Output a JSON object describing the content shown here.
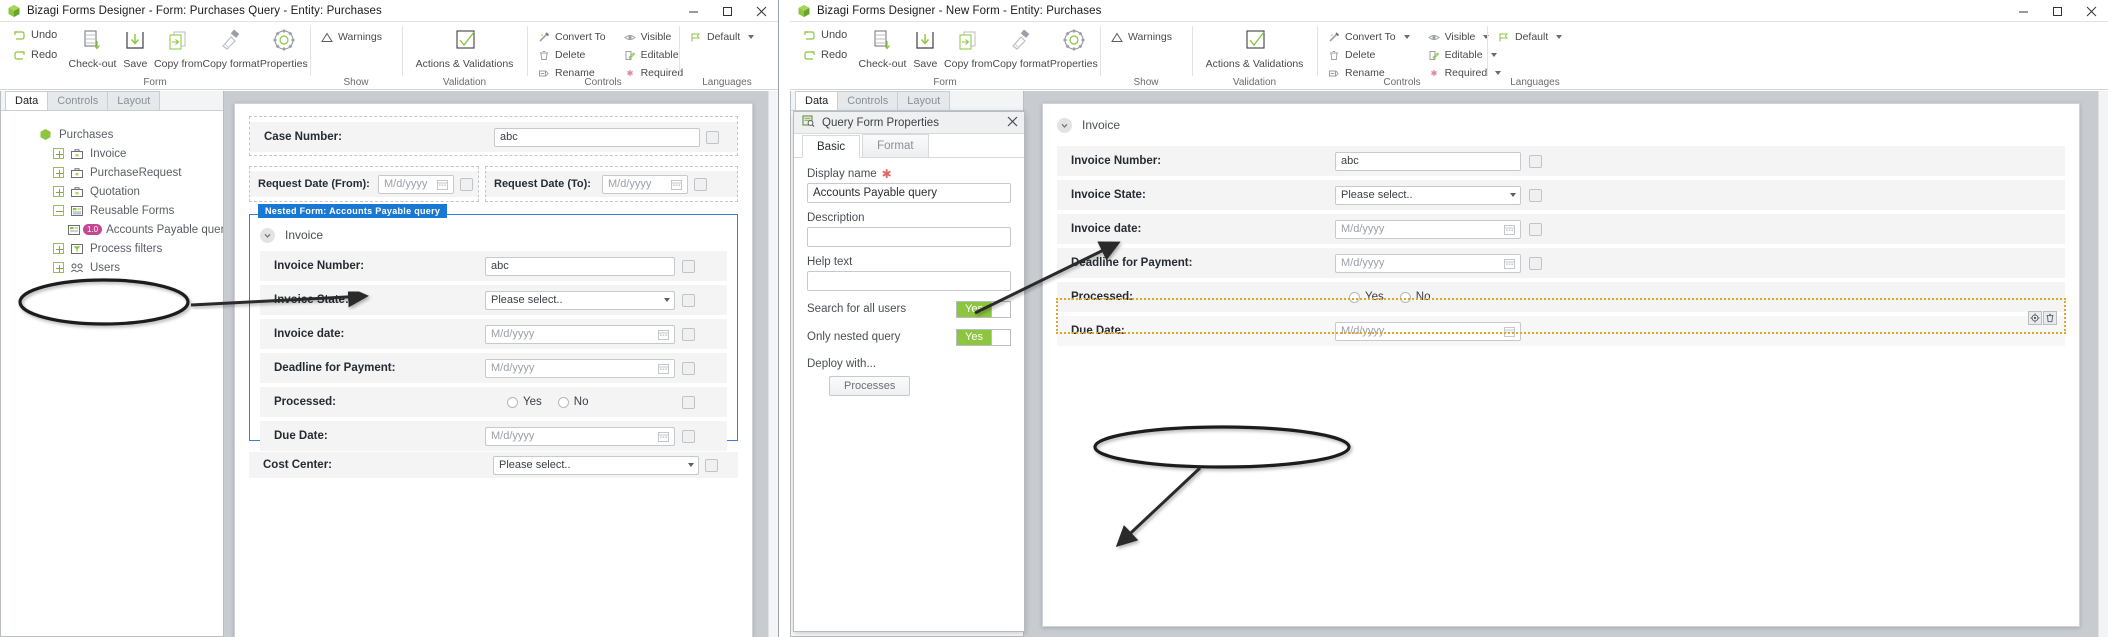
{
  "left_window": {
    "title": "Bizagi Forms Designer  - Form: Purchases Query - Entity:  Purchases",
    "window_controls": {
      "minimize": "minimize-icon",
      "maximize": "maximize-icon",
      "close": "close-icon"
    },
    "ribbon": {
      "groups": [
        {
          "label": "Form",
          "small_commands": [
            {
              "label": "Undo",
              "icon": "undo-icon"
            },
            {
              "label": "Redo",
              "icon": "redo-icon"
            }
          ],
          "big_commands": [
            {
              "label": "Check-out",
              "icon": "check-out-icon"
            },
            {
              "label": "Save",
              "icon": "save-icon"
            },
            {
              "label": "Copy from",
              "icon": "copy-from-icon"
            },
            {
              "label": "Copy format",
              "icon": "copy-format-icon"
            },
            {
              "label": "Properties",
              "icon": "gear-icon"
            }
          ]
        },
        {
          "label": "Show",
          "small_commands": [
            {
              "label": "Warnings",
              "icon": "warning-triangle-icon"
            }
          ],
          "big_commands": []
        },
        {
          "label": "Validation",
          "small_commands": [],
          "big_commands": [
            {
              "label": "Actions & Validations",
              "icon": "checkmark-box-icon"
            }
          ]
        },
        {
          "label": "Controls",
          "small_commands": [
            {
              "label": "Convert To",
              "icon": "convert-to-icon"
            },
            {
              "label": "Delete",
              "icon": "trash-icon"
            },
            {
              "label": "Rename",
              "icon": "rename-icon"
            }
          ],
          "small_commands_2": [
            {
              "label": "Visible",
              "icon": "eye-icon"
            },
            {
              "label": "Editable",
              "icon": "editable-icon"
            },
            {
              "label": "Required",
              "icon": "asterisk-icon"
            }
          ],
          "big_commands": []
        },
        {
          "label": "Languages",
          "small_commands": [
            {
              "label": "Default",
              "icon": "flag-icon",
              "has_caret": true
            }
          ],
          "big_commands": []
        }
      ]
    },
    "panel_tabs": [
      {
        "label": "Data",
        "active": true
      },
      {
        "label": "Controls",
        "active": false
      },
      {
        "label": "Layout",
        "active": false
      }
    ],
    "tree": [
      {
        "label": "Purchases",
        "indent": 0,
        "icon": "entity-icon",
        "expander": "none"
      },
      {
        "label": "Invoice",
        "indent": 1,
        "icon": "briefcase-icon",
        "expander": "plus"
      },
      {
        "label": "PurchaseRequest",
        "indent": 1,
        "icon": "briefcase-icon",
        "expander": "plus"
      },
      {
        "label": "Quotation",
        "indent": 1,
        "icon": "briefcase-icon",
        "expander": "plus"
      },
      {
        "label": "Reusable Forms",
        "indent": 1,
        "icon": "reusable-forms-icon",
        "expander": "minus"
      },
      {
        "label": "Accounts Payable query",
        "indent": 2,
        "icon": "query-form-icon",
        "expander": "none",
        "badge": "1.0"
      },
      {
        "label": "Process filters",
        "indent": 1,
        "icon": "filter-icon",
        "expander": "plus"
      },
      {
        "label": "Users",
        "indent": 1,
        "icon": "users-icon",
        "expander": "plus"
      }
    ],
    "form": {
      "fields": [
        {
          "label": "Case Number:",
          "type": "text",
          "value": "abc"
        },
        {
          "label": "Request Date (From):",
          "type": "date",
          "placeholder": "M/d/yyyy"
        },
        {
          "label": "Request Date (To):",
          "type": "date",
          "placeholder": "M/d/yyyy"
        }
      ],
      "nested_form_tag": "Nested Form: Accounts Payable query",
      "nested_section_title": "Invoice",
      "nested_fields": [
        {
          "label": "Invoice Number:",
          "type": "text",
          "value": "abc"
        },
        {
          "label": "Invoice State:",
          "type": "select",
          "value": "Please select.."
        },
        {
          "label": "Invoice date:",
          "type": "date",
          "placeholder": "M/d/yyyy"
        },
        {
          "label": "Deadline for Payment:",
          "type": "date",
          "placeholder": "M/d/yyyy"
        },
        {
          "label": "Processed:",
          "type": "radio",
          "options": [
            "Yes",
            "No"
          ]
        },
        {
          "label": "Due Date:",
          "type": "date",
          "placeholder": "M/d/yyyy"
        }
      ],
      "bottom_field": {
        "label": "Cost Center:",
        "type": "select",
        "value": "Please select.."
      }
    }
  },
  "right_window": {
    "title": "Bizagi Forms Designer  - New Form - Entity:  Purchases",
    "ribbon": {
      "groups": [
        {
          "label": "Form",
          "small_commands": [
            {
              "label": "Undo",
              "icon": "undo-icon"
            },
            {
              "label": "Redo",
              "icon": "redo-icon"
            }
          ],
          "big_commands": [
            {
              "label": "Check-out",
              "icon": "check-out-icon"
            },
            {
              "label": "Save",
              "icon": "save-icon"
            },
            {
              "label": "Copy from",
              "icon": "copy-from-icon"
            },
            {
              "label": "Copy format",
              "icon": "copy-format-icon"
            },
            {
              "label": "Properties",
              "icon": "gear-icon"
            }
          ]
        },
        {
          "label": "Show",
          "small_commands": [
            {
              "label": "Warnings",
              "icon": "warning-triangle-icon"
            }
          ],
          "big_commands": []
        },
        {
          "label": "Validation",
          "small_commands": [],
          "big_commands": [
            {
              "label": "Actions & Validations",
              "icon": "checkmark-box-icon"
            }
          ]
        },
        {
          "label": "Controls",
          "small_commands": [
            {
              "label": "Convert To",
              "icon": "convert-to-icon",
              "has_caret": true
            },
            {
              "label": "Delete",
              "icon": "trash-icon"
            },
            {
              "label": "Rename",
              "icon": "rename-icon"
            }
          ],
          "small_commands_2": [
            {
              "label": "Visible",
              "icon": "eye-icon",
              "has_caret": true
            },
            {
              "label": "Editable",
              "icon": "editable-icon",
              "has_caret": true
            },
            {
              "label": "Required",
              "icon": "asterisk-icon",
              "has_caret": true
            }
          ],
          "big_commands": []
        },
        {
          "label": "Languages",
          "small_commands": [
            {
              "label": "Default",
              "icon": "flag-icon",
              "has_caret": true
            }
          ],
          "big_commands": []
        }
      ]
    },
    "panel_tabs": [
      {
        "label": "Data",
        "active": true
      },
      {
        "label": "Controls",
        "active": false
      },
      {
        "label": "Layout",
        "active": false
      }
    ],
    "properties_dialog": {
      "title": "Query Form Properties",
      "title_icon": "query-form-properties-icon",
      "close_icon": "close-icon",
      "tabs": [
        {
          "label": "Basic",
          "active": true
        },
        {
          "label": "Format",
          "active": false
        }
      ],
      "fields": [
        {
          "label": "Display name",
          "required": true,
          "value": "Accounts Payable query"
        },
        {
          "label": "Description",
          "required": false,
          "value": ""
        },
        {
          "label": "Help text",
          "required": false,
          "value": ""
        }
      ],
      "toggles": [
        {
          "label": "Search for all users",
          "value": "Yes"
        },
        {
          "label": "Only nested query",
          "value": "Yes"
        }
      ],
      "deploy_label": "Deploy with...",
      "deploy_button": "Processes"
    },
    "form": {
      "section_title": "Invoice",
      "fields": [
        {
          "label": "Invoice Number:",
          "type": "text",
          "value": "abc"
        },
        {
          "label": "Invoice State:",
          "type": "select",
          "value": "Please select.."
        },
        {
          "label": "Invoice date:",
          "type": "date",
          "placeholder": "M/d/yyyy"
        },
        {
          "label": "Deadline for Payment:",
          "type": "date",
          "placeholder": "M/d/yyyy"
        },
        {
          "label": "Processed:",
          "type": "radio",
          "options": [
            "Yes",
            "No"
          ]
        },
        {
          "label": "Due Date:",
          "type": "date",
          "placeholder": "M/d/yyyy",
          "selected": true
        }
      ],
      "selected_row_tools": [
        "gear-icon",
        "trash-icon"
      ]
    }
  },
  "annotations": {
    "ellipse_tree_item": "Accounts Payable query",
    "ellipse_toggle": "Only nested query",
    "arrow_1": "tree-item-to-nested-form-tag",
    "arrow_2": "nested-form-to-display-name",
    "arrow_3": "only-nested-query-to-form"
  },
  "colors": {
    "accent_green": "#8cc63e",
    "nested_blue": "#1878d4",
    "badge_pink": "#c7478f",
    "selection_orange": "#e0a52a",
    "required_red": "#e06666",
    "workarea_gray": "#c8ccd1"
  }
}
